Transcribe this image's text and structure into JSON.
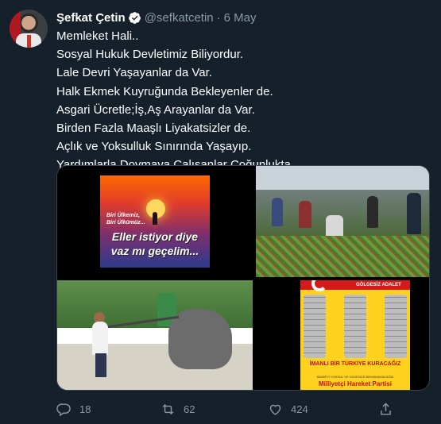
{
  "author": {
    "name": "Şefkat Çetin",
    "handle": "@sefkatcetin",
    "separator": "·",
    "date": "6 May"
  },
  "tweet_lines": [
    "Memleket Hali..",
    "Sosyal Hukuk Devletimiz Biliyordur.",
    "Lale Devri Yaşayanlar da Var.",
    "Halk Ekmek Kuyruğunda Bekleyenler de.",
    "Asgari Ücretle;İş,Aş Arayanlar da Var.",
    "Birden Fazla Maaşlı Liyakatsizler de.",
    "Açlık ve Yoksulluk Sınırında Yaşayıp.",
    "Yardımlarla Doymaya Çalışanlar Çoğunlukta."
  ],
  "media": {
    "poster1": {
      "small_text": "Biri Ülkemiz,\nBiri Ülkümüz...",
      "big_text": "Eller istiyor diye vaz mı geçelim..."
    },
    "poster2": {
      "tag": "GÖLGESİZ ADALET",
      "line1": "İMANLI BİR TÜRKİYE KURACAĞIZ",
      "line2": "KİMSEYİ YOKSUL VE GÜVENCE BIRAKMAYACAĞIZ",
      "line3": "Milliyetçi Hareket Partisi"
    }
  },
  "actions": {
    "reply_count": "18",
    "retweet_count": "62",
    "like_count": "424"
  },
  "colors": {
    "background": "#15202b",
    "text": "#ffffff",
    "secondary": "#8899a6",
    "verified": "#ffffff"
  }
}
